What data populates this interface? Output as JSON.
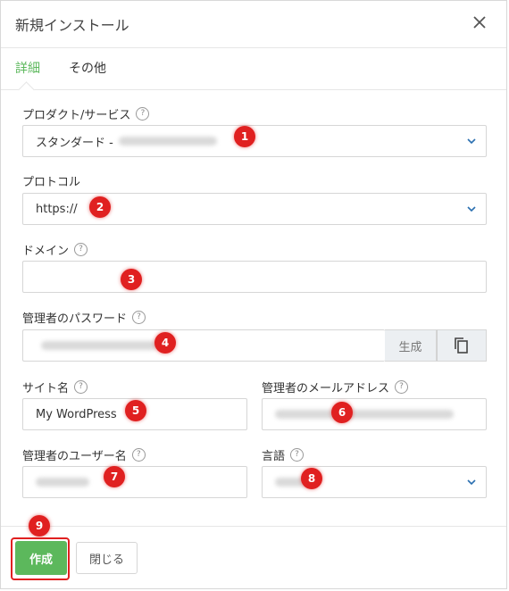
{
  "dialog": {
    "title": "新規インストール"
  },
  "tabs": [
    {
      "label": "詳細"
    },
    {
      "label": "その他"
    }
  ],
  "fields": {
    "product": {
      "label": "プロダクト/サービス",
      "value": "スタンダード -"
    },
    "protocol": {
      "label": "プロトコル",
      "value": "https://"
    },
    "domain": {
      "label": "ドメイン",
      "value": ""
    },
    "password": {
      "label": "管理者のパスワード",
      "value": "",
      "generate_label": "生成"
    },
    "site_name": {
      "label": "サイト名",
      "value": "My WordPress"
    },
    "admin_email": {
      "label": "管理者のメールアドレス",
      "value": ""
    },
    "admin_user": {
      "label": "管理者のユーザー名",
      "value": ""
    },
    "language": {
      "label": "言語",
      "value": ""
    }
  },
  "markers": [
    "1",
    "2",
    "3",
    "4",
    "5",
    "6",
    "7",
    "8",
    "9"
  ],
  "footer": {
    "create_label": "作成",
    "close_label": "閉じる"
  },
  "colors": {
    "accent_green": "#5cb85c",
    "marker_red": "#e02020"
  }
}
